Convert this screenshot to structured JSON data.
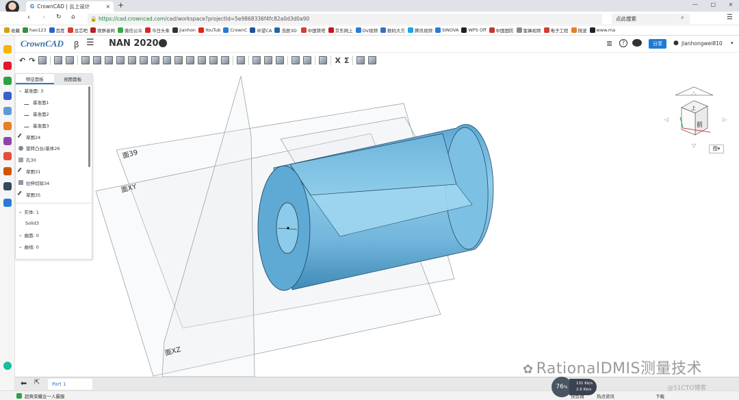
{
  "browser": {
    "tab_title": "CrownCAD | 云上设计",
    "url_host": "https://cad.crowncad.com",
    "url_path": "/cad/workspace?projectId=5e9868336f4fc82a0d3d0a90",
    "search_text": "点此搜索",
    "bookmarks": [
      "收藏",
      "hao123",
      "百度",
      "龙芯吧",
      "观察者网",
      "微信公众",
      "今日头条",
      "jianhon",
      "YouTub",
      "CrownC",
      "中望CA",
      "浩辰3D·",
      "中国铁塔",
      "京东网上",
      "DV视频",
      "数码大方",
      "腾讯视频",
      "SINOVA",
      "WPS Off",
      "中国国防",
      "蜜蜂视频",
      "电子工程",
      "微波",
      "www.ma"
    ],
    "bookmark_colors": [
      "#d4a017",
      "#3a8f3a",
      "#2e63c8",
      "#d23f31",
      "#b22222",
      "#36a84a",
      "#d62828",
      "#333333",
      "#e62117",
      "#2b7bd6",
      "#1e4f9c",
      "#2266aa",
      "#d23f31",
      "#c4161c",
      "#2b7bd6",
      "#3a6fc2",
      "#1aa3e8",
      "#2b7bd6",
      "#222222",
      "#c0392b",
      "#888888",
      "#d23f31",
      "#e67e22",
      "#222222"
    ]
  },
  "app": {
    "logo": "CrownCAD",
    "logo_glyph": "ꞵ",
    "project_name": "NAN 2020",
    "share_label": "分享",
    "user_name": "Jianhongwei810"
  },
  "panel": {
    "tab_features": "特征面板",
    "tab_views": "视图面板",
    "group_planes": "基准面: 3",
    "items": [
      "基准面1",
      "基准面2",
      "基准面3",
      "草图24",
      "旋转凸台/基体26",
      "孔30",
      "草图31",
      "拉伸切除34",
      "草图35"
    ],
    "entities": "实体: 1",
    "solid": "Solid3",
    "surfaces": "曲面: 0",
    "curves": "曲线: 0"
  },
  "viewport": {
    "plane_labels": [
      "面39",
      "面XY",
      "面XZ"
    ],
    "viewcube_top": "上",
    "viewcube_front": "前",
    "view_menu": "图▾"
  },
  "bottom": {
    "part_tab": "Part 1",
    "status_left": "超爽荣耀业一人霸服",
    "status_items": [
      "快剪辑",
      "热点资讯"
    ],
    "speed_pct": "76",
    "speed_up": "131 Kb/s",
    "speed_down": "2.6 Kb/s",
    "download": "下载"
  },
  "watermark": {
    "main": "RationalDMIS测量技术",
    "sub": "@51CTO博客"
  },
  "colors": {
    "accent": "#1f7ad6",
    "part_blue": "#7fbfe0",
    "part_dark": "#4a93bd"
  }
}
